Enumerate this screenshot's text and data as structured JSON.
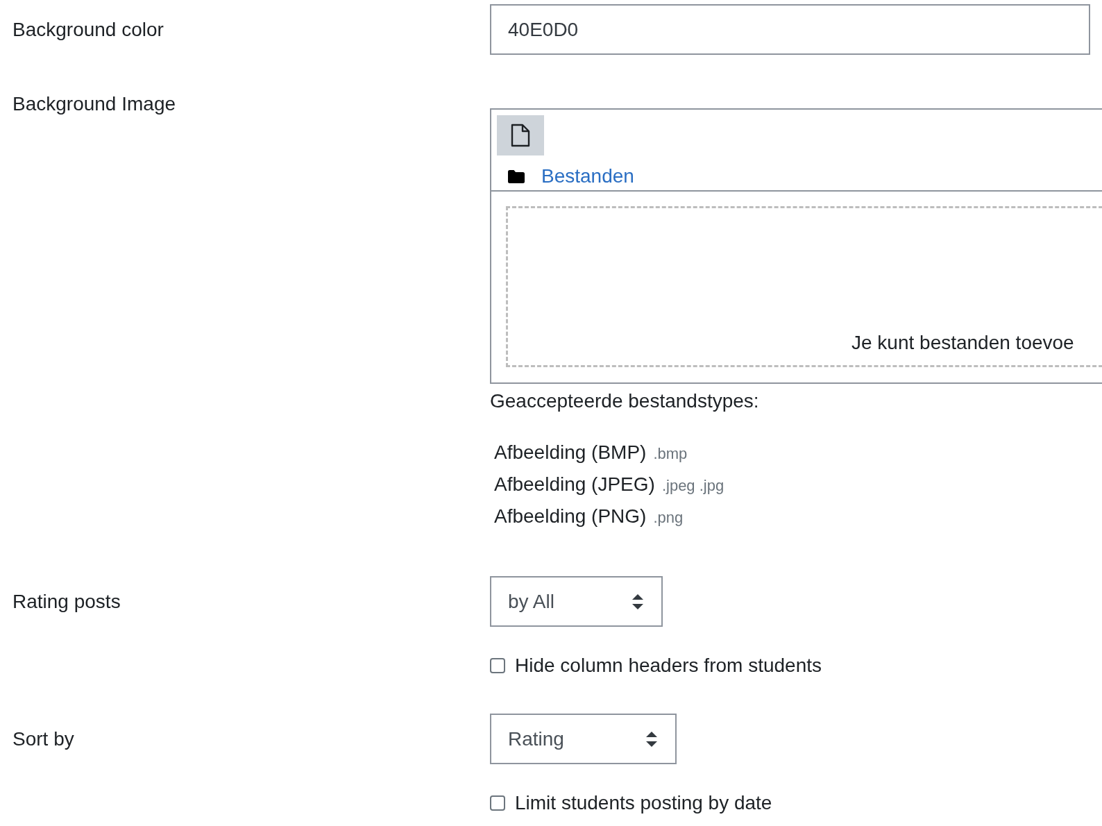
{
  "fields": [
    {
      "kind": "text",
      "label": "Background color",
      "value": "40E0D0"
    },
    {
      "kind": "filepicker",
      "label": "Background Image",
      "folder_link": "Bestanden",
      "drop_hint": "Je kunt bestanden toevoe",
      "accepted_title": "Geaccepteerde bestandstypes:",
      "accepted": [
        {
          "name": "Afbeelding (BMP)",
          "ext": ".bmp"
        },
        {
          "name": "Afbeelding (JPEG)",
          "ext": ".jpeg .jpg"
        },
        {
          "name": "Afbeelding (PNG)",
          "ext": ".png"
        }
      ]
    },
    {
      "kind": "select",
      "label": "Rating posts",
      "value": "by All"
    },
    {
      "kind": "checkbox",
      "text": "Hide column headers from students",
      "checked": false
    },
    {
      "kind": "select",
      "label": "Sort by",
      "value": "Rating"
    },
    {
      "kind": "checkbox",
      "text": "Limit students posting by date",
      "checked": false
    }
  ]
}
